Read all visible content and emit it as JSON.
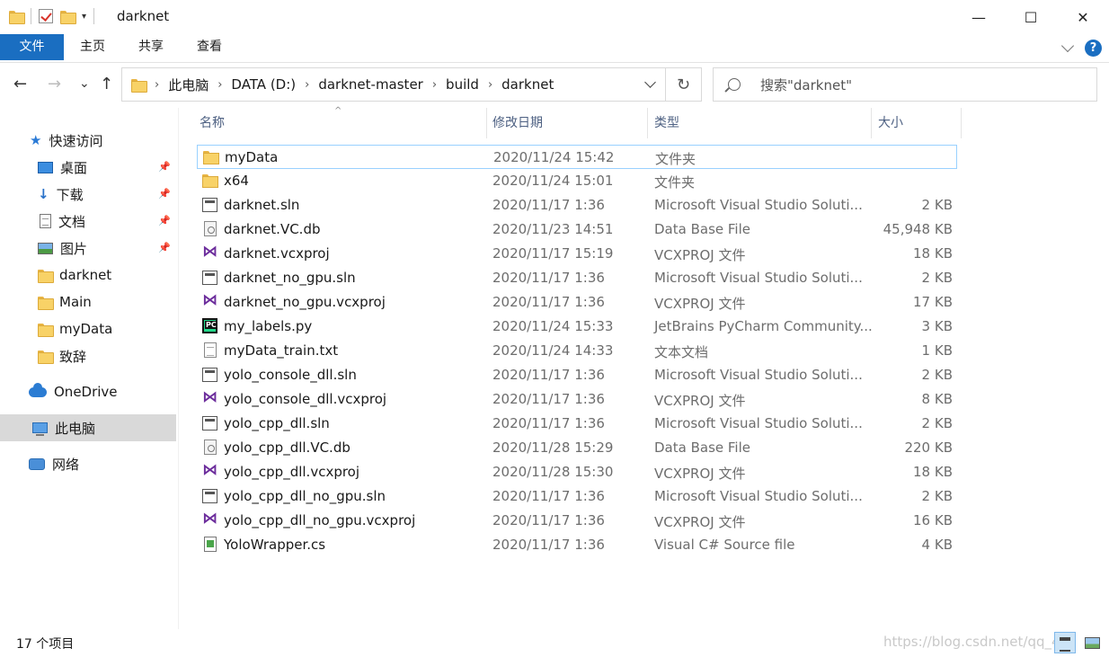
{
  "window": {
    "title": "darknet",
    "minimize_glyph": "—",
    "maximize_glyph": "☐",
    "close_glyph": "✕"
  },
  "ribbon": {
    "tabs": [
      "文件",
      "主页",
      "共享",
      "查看"
    ],
    "help_glyph": "?"
  },
  "nav": {
    "back_glyph": "←",
    "forward_glyph": "→",
    "recent_glyph": "⌄",
    "up_glyph": "↑",
    "refresh_glyph": "↻"
  },
  "breadcrumb": [
    "此电脑",
    "DATA (D:)",
    "darknet-master",
    "build",
    "darknet"
  ],
  "search": {
    "placeholder": "搜索\"darknet\""
  },
  "sidebar": {
    "items": [
      {
        "label": "快速访问",
        "icon": "star-icon"
      },
      {
        "label": "桌面",
        "icon": "desktop-icon",
        "pinned": true
      },
      {
        "label": "下载",
        "icon": "download-icon",
        "pinned": true
      },
      {
        "label": "文档",
        "icon": "document-icon",
        "pinned": true
      },
      {
        "label": "图片",
        "icon": "pictures-icon",
        "pinned": true
      },
      {
        "label": "darknet",
        "icon": "folder-icon"
      },
      {
        "label": "Main",
        "icon": "folder-icon"
      },
      {
        "label": "myData",
        "icon": "folder-icon"
      },
      {
        "label": "致辞",
        "icon": "folder-icon"
      },
      {
        "label": "OneDrive",
        "icon": "onedrive-icon"
      },
      {
        "label": "此电脑",
        "icon": "this-pc-icon",
        "selected": true
      },
      {
        "label": "网络",
        "icon": "network-icon"
      }
    ]
  },
  "columns": {
    "name": "名称",
    "date": "修改日期",
    "type": "类型",
    "size": "大小"
  },
  "files": [
    {
      "name": "myData",
      "date": "2020/11/24 15:42",
      "type": "文件夹",
      "size": "",
      "icon": "folder-icon",
      "selected": true
    },
    {
      "name": "x64",
      "date": "2020/11/24 15:01",
      "type": "文件夹",
      "size": "",
      "icon": "folder-icon"
    },
    {
      "name": "darknet.sln",
      "date": "2020/11/17 1:36",
      "type": "Microsoft Visual Studio Soluti...",
      "size": "2 KB",
      "icon": "sln-icon"
    },
    {
      "name": "darknet.VC.db",
      "date": "2020/11/23 14:51",
      "type": "Data Base File",
      "size": "45,948 KB",
      "icon": "db-icon"
    },
    {
      "name": "darknet.vcxproj",
      "date": "2020/11/17 15:19",
      "type": "VCXPROJ 文件",
      "size": "18 KB",
      "icon": "vcxproj-icon"
    },
    {
      "name": "darknet_no_gpu.sln",
      "date": "2020/11/17 1:36",
      "type": "Microsoft Visual Studio Soluti...",
      "size": "2 KB",
      "icon": "sln-icon"
    },
    {
      "name": "darknet_no_gpu.vcxproj",
      "date": "2020/11/17 1:36",
      "type": "VCXPROJ 文件",
      "size": "17 KB",
      "icon": "vcxproj-icon"
    },
    {
      "name": "my_labels.py",
      "date": "2020/11/24 15:33",
      "type": "JetBrains PyCharm Community...",
      "size": "3 KB",
      "icon": "pycharm-icon"
    },
    {
      "name": "myData_train.txt",
      "date": "2020/11/24 14:33",
      "type": "文本文档",
      "size": "1 KB",
      "icon": "text-file-icon"
    },
    {
      "name": "yolo_console_dll.sln",
      "date": "2020/11/17 1:36",
      "type": "Microsoft Visual Studio Soluti...",
      "size": "2 KB",
      "icon": "sln-icon"
    },
    {
      "name": "yolo_console_dll.vcxproj",
      "date": "2020/11/17 1:36",
      "type": "VCXPROJ 文件",
      "size": "8 KB",
      "icon": "vcxproj-icon"
    },
    {
      "name": "yolo_cpp_dll.sln",
      "date": "2020/11/17 1:36",
      "type": "Microsoft Visual Studio Soluti...",
      "size": "2 KB",
      "icon": "sln-icon"
    },
    {
      "name": "yolo_cpp_dll.VC.db",
      "date": "2020/11/28 15:29",
      "type": "Data Base File",
      "size": "220 KB",
      "icon": "db-icon"
    },
    {
      "name": "yolo_cpp_dll.vcxproj",
      "date": "2020/11/28 15:30",
      "type": "VCXPROJ 文件",
      "size": "18 KB",
      "icon": "vcxproj-icon"
    },
    {
      "name": "yolo_cpp_dll_no_gpu.sln",
      "date": "2020/11/17 1:36",
      "type": "Microsoft Visual Studio Soluti...",
      "size": "2 KB",
      "icon": "sln-icon"
    },
    {
      "name": "yolo_cpp_dll_no_gpu.vcxproj",
      "date": "2020/11/17 1:36",
      "type": "VCXPROJ 文件",
      "size": "16 KB",
      "icon": "vcxproj-icon"
    },
    {
      "name": "YoloWrapper.cs",
      "date": "2020/11/17 1:36",
      "type": "Visual C# Source file",
      "size": "4 KB",
      "icon": "csharp-file-icon"
    }
  ],
  "status": {
    "item_count": "17 个项目",
    "watermark": "https://blog.csdn.net/qq_4"
  },
  "colors": {
    "accent": "#1a6ec1",
    "selection_border": "#99d1ff",
    "sidebar_selected": "#d9d9d9"
  }
}
